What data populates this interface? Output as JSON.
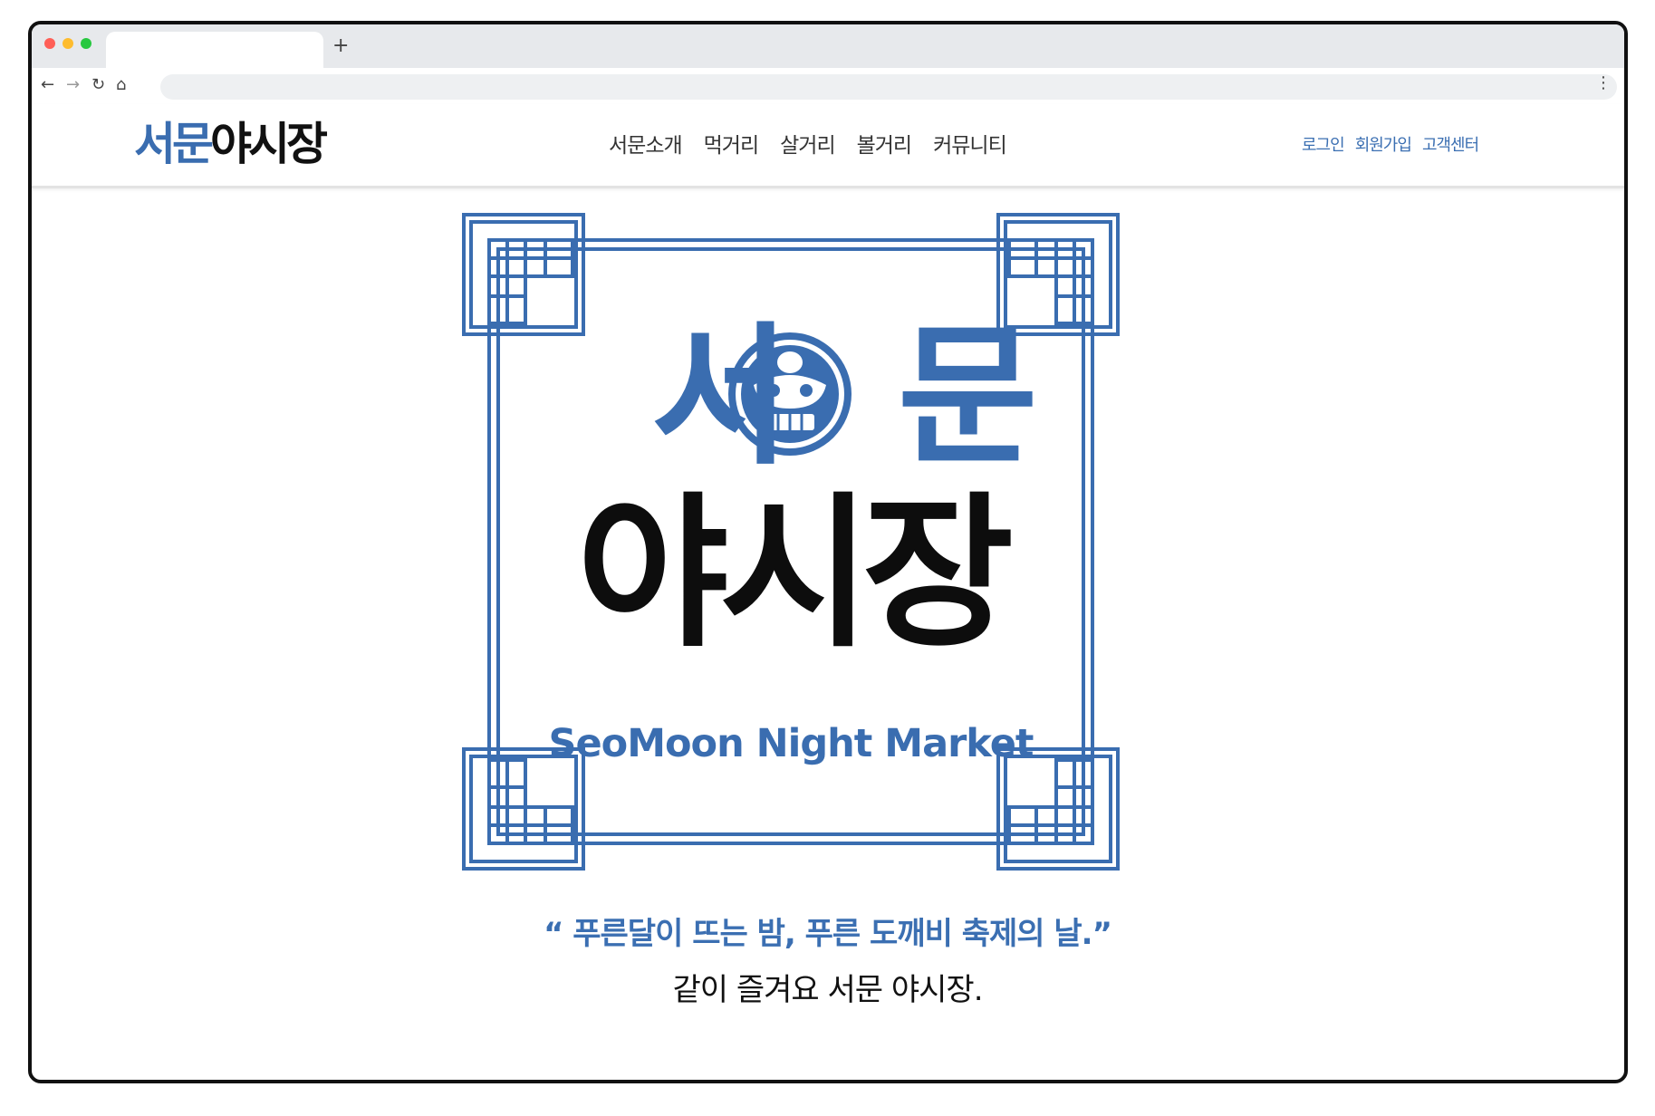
{
  "browser": {
    "new_tab_icon": "plus-icon",
    "back_icon": "arrow-left-icon",
    "forward_icon": "arrow-right-icon",
    "reload_icon": "reload-icon",
    "home_icon": "home-icon",
    "menu_icon": "vertical-dots-icon",
    "address": ""
  },
  "header": {
    "logo_part1": "서문",
    "logo_part2": "야시장",
    "nav": [
      "서문소개",
      "먹거리",
      "살거리",
      "볼거리",
      "커뮤니티"
    ],
    "util": [
      "로그인",
      "회원가입",
      "고객센터"
    ]
  },
  "hero": {
    "title_line1_left": "서",
    "title_line1_right": "문",
    "title_line2": "야시장",
    "english_name": "SeoMoon Night Market",
    "emblem_icon": "dokkaebi-emblem-icon",
    "tagline": "“ 푸른달이 뜨는 밤, 푸른 도깨비 축제의 날.”",
    "subline": "같이 즐겨요 서문 야시장."
  },
  "colors": {
    "brand_blue": "#3a6db0",
    "text_black": "#111111"
  }
}
